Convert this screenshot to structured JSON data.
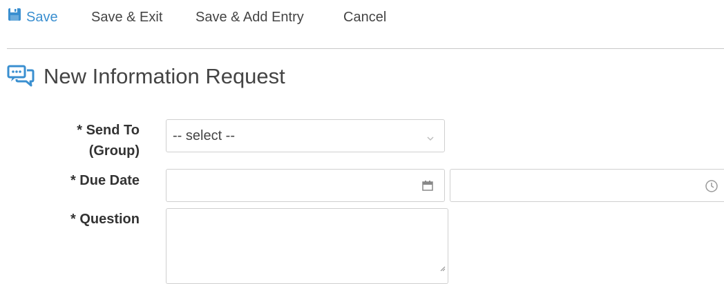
{
  "toolbar": {
    "save_label": "Save",
    "save_exit_label": "Save & Exit",
    "save_add_label": "Save & Add Entry",
    "cancel_label": "Cancel",
    "save_icon": "floppy-disk-icon"
  },
  "page": {
    "title": "New Information Request",
    "title_icon": "chat-bubbles-icon"
  },
  "form": {
    "send_to": {
      "label_line1": "* Send To",
      "label_line2": "(Group)",
      "value": "-- select --"
    },
    "due_date": {
      "label": "* Due Date",
      "date_value": "",
      "time_value": "",
      "date_icon": "calendar-icon",
      "time_icon": "clock-icon"
    },
    "question": {
      "label": "* Question",
      "value": ""
    }
  },
  "colors": {
    "accent": "#3a8fd0",
    "border": "#cfcfcf",
    "text": "#333333"
  }
}
